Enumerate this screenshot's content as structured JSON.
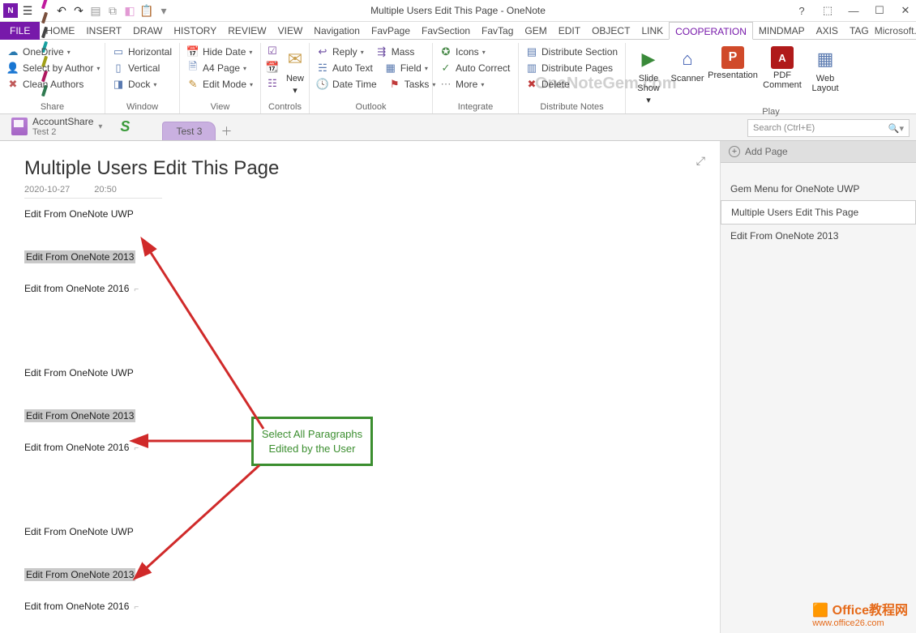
{
  "window": {
    "title": "Multiple Users Edit This Page - OneNote"
  },
  "qat": {
    "pen_colors": [
      "#6a2fb5",
      "#c01818",
      "#d38f1a",
      "#2f8a2f",
      "#1a57c0",
      "#c01a9e",
      "#7a503d",
      "#444",
      "#18a0a0",
      "#a0a018",
      "#b01860",
      "#2f7a50"
    ]
  },
  "menu": {
    "file": "FILE",
    "items": [
      "HOME",
      "INSERT",
      "DRAW",
      "HISTORY",
      "REVIEW",
      "VIEW",
      "Navigation",
      "FavPage",
      "FavSection",
      "FavTag",
      "GEM",
      "EDIT",
      "OBJECT",
      "LINK",
      "COOPERATION",
      "MINDMAP",
      "AXIS",
      "TAG"
    ],
    "active": "COOPERATION",
    "microsoft": "Microsoft..."
  },
  "ribbon": {
    "share": {
      "label": "Share",
      "onedrive": "OneDrive",
      "select_by_author": "Select by Author",
      "clean_authors": "Clean Authors"
    },
    "window": {
      "label": "Window",
      "horizontal": "Horizontal",
      "vertical": "Vertical",
      "dock": "Dock"
    },
    "view": {
      "label": "View",
      "hide_date": "Hide Date",
      "a4_page": "A4 Page",
      "edit_mode": "Edit Mode"
    },
    "controls": {
      "label": "Controls",
      "new": "New"
    },
    "outlook": {
      "label": "Outlook",
      "reply": "Reply",
      "mass": "Mass",
      "auto_text": "Auto Text",
      "field": "Field",
      "date_time": "Date Time",
      "tasks": "Tasks"
    },
    "integrate": {
      "label": "Integrate",
      "icons": "Icons",
      "auto_correct": "Auto Correct",
      "more": "More"
    },
    "distribute": {
      "label": "Distribute Notes",
      "section": "Distribute Section",
      "pages": "Distribute Pages",
      "delete": "Delete"
    },
    "play": {
      "label": "Play",
      "slide_show": "Slide Show",
      "scanner": "Scanner",
      "presentation": "Presentation",
      "pdf_comment": "PDF Comment",
      "web_layout": "Web Layout"
    }
  },
  "notebook": {
    "name": "AccountShare",
    "section": "Test 2",
    "tab": "Test 3",
    "search_placeholder": "Search (Ctrl+E)"
  },
  "page": {
    "title": "Multiple Users Edit This Page",
    "date": "2020-10-27",
    "time": "20:50",
    "lines": [
      {
        "text": "Edit From OneNote UWP",
        "selected": false
      },
      {
        "text": "Edit From OneNote 2013",
        "selected": true
      },
      {
        "text": "Edit from OneNote 2016",
        "selected": false
      },
      {
        "text": "Edit From OneNote UWP",
        "selected": false
      },
      {
        "text": "Edit From OneNote 2013",
        "selected": true
      },
      {
        "text": "Edit from OneNote 2016",
        "selected": false
      },
      {
        "text": "Edit From OneNote UWP",
        "selected": false
      },
      {
        "text": "Edit From OneNote 2013",
        "selected": true
      },
      {
        "text": "Edit from OneNote 2016",
        "selected": false
      }
    ],
    "annotation": "Select All Paragraphs Edited by the User"
  },
  "page_list": {
    "add": "Add Page",
    "items": [
      "Gem Menu for OneNote UWP",
      "Multiple Users Edit This Page",
      "Edit From OneNote 2013"
    ],
    "selected": 1
  },
  "watermark": "OneNoteGem.com",
  "footer_logo": {
    "big": "Office教程网",
    "small": "www.office26.com"
  }
}
